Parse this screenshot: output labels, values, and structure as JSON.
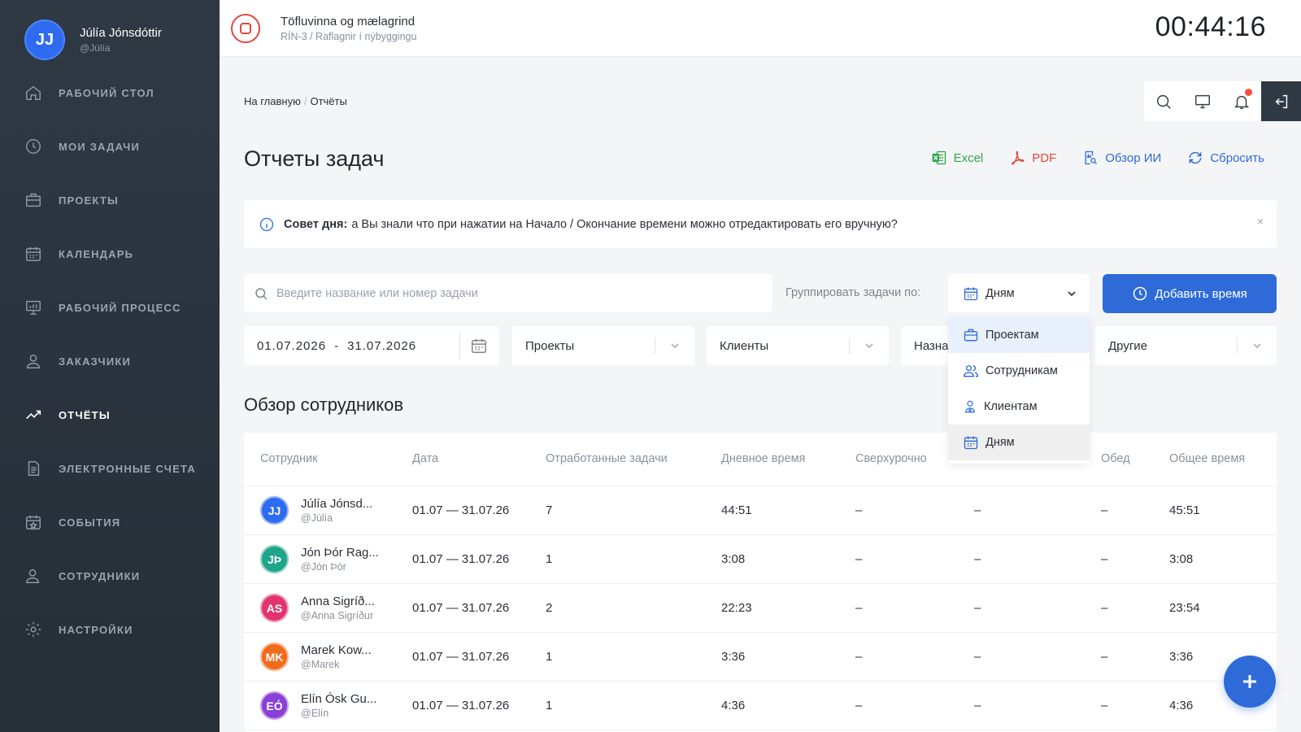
{
  "user": {
    "initials": "JJ",
    "name": "Júlía Jónsdóttir",
    "handle": "@Júlía"
  },
  "nav": [
    {
      "label": "РАБОЧИЙ СТОЛ",
      "icon": "home-icon"
    },
    {
      "label": "МОИ ЗАДАЧИ",
      "icon": "clock-icon"
    },
    {
      "label": "ПРОЕКТЫ",
      "icon": "briefcase-icon"
    },
    {
      "label": "КАЛЕНДАРЬ",
      "icon": "calendar-icon"
    },
    {
      "label": "РАБОЧИЙ ПРОЦЕСС",
      "icon": "presentation-icon"
    },
    {
      "label": "ЗАКАЗЧИКИ",
      "icon": "user-icon"
    },
    {
      "label": "ОТЧЁТЫ",
      "icon": "trend-icon",
      "active": true
    },
    {
      "label": "ЭЛЕКТРОННЫЕ СЧЕТА",
      "icon": "document-icon"
    },
    {
      "label": "СОБЫТИЯ",
      "icon": "calendar-star-icon"
    },
    {
      "label": "СОТРУДНИКИ",
      "icon": "users-icon"
    },
    {
      "label": "НАСТРОЙКИ",
      "icon": "gear-icon"
    }
  ],
  "topbar": {
    "task_title": "Töfluvinna og mælagrind",
    "task_sub": "RÍN-3 / Raflagnir í nýbyggingu",
    "timer": "00:44:16"
  },
  "breadcrumb": {
    "home": "На главную",
    "sep": "/",
    "current": "Отчёты"
  },
  "page_title": "Отчеты задач",
  "actions": {
    "excel": "Excel",
    "pdf": "PDF",
    "ai": "Обзор ИИ",
    "reset": "Сбросить"
  },
  "tip": {
    "label": "Совет дня:",
    "text": "а Вы знали что при нажатии на Начало / Окончание времени можно отредактировать его вручную?",
    "close": "×"
  },
  "search": {
    "placeholder": "Введите название или номер задачи"
  },
  "group": {
    "label": "Группировать задачи по:",
    "selected": "Дням",
    "options": [
      "Проектам",
      "Сотрудникам",
      "Клиентам",
      "Дням"
    ]
  },
  "add_time": "Добавить время",
  "filters": {
    "date_from": "01.07.2026",
    "date_sep": "-",
    "date_to": "31.07.2026",
    "projects": "Проекты",
    "clients": "Клиенты",
    "nazn": "Назна",
    "other": "Другие"
  },
  "section_title": "Обзор сотрудников",
  "table": {
    "headers": [
      "Сотрудник",
      "Дата",
      "Отработанные задачи",
      "Дневное время",
      "Сверхурочно",
      "Обед",
      "Общее время"
    ],
    "rows": [
      {
        "initials": "JJ",
        "color": "#2e6bf0",
        "name": "Júlía Jónsd...",
        "handle": "@Júlía",
        "date": "01.07 — 31.07.26",
        "tasks": "7",
        "day": "44:51",
        "over": "–",
        "c6": "–",
        "lunch": "–",
        "total": "45:51"
      },
      {
        "initials": "JÞ",
        "color": "#1fa58a",
        "name": "Jón Þór Rag...",
        "handle": "@Jón Þór",
        "date": "01.07 — 31.07.26",
        "tasks": "1",
        "day": "3:08",
        "over": "–",
        "c6": "–",
        "lunch": "–",
        "total": "3:08"
      },
      {
        "initials": "AS",
        "color": "#e2336f",
        "name": "Anna Sigríð...",
        "handle": "@Anna Sigríður",
        "date": "01.07 — 31.07.26",
        "tasks": "2",
        "day": "22:23",
        "over": "–",
        "c6": "–",
        "lunch": "–",
        "total": "23:54"
      },
      {
        "initials": "MK",
        "color": "#f26b1d",
        "name": "Marek Kow...",
        "handle": "@Marek",
        "date": "01.07 — 31.07.26",
        "tasks": "1",
        "day": "3:36",
        "over": "–",
        "c6": "–",
        "lunch": "–",
        "total": "3:36"
      },
      {
        "initials": "EÓ",
        "color": "#8a3fd6",
        "name": "Elín Ósk Gu...",
        "handle": "@Elín",
        "date": "01.07 — 31.07.26",
        "tasks": "1",
        "day": "4:36",
        "over": "–",
        "c6": "–",
        "lunch": "–",
        "total": "4:36"
      }
    ]
  },
  "fab": "+"
}
